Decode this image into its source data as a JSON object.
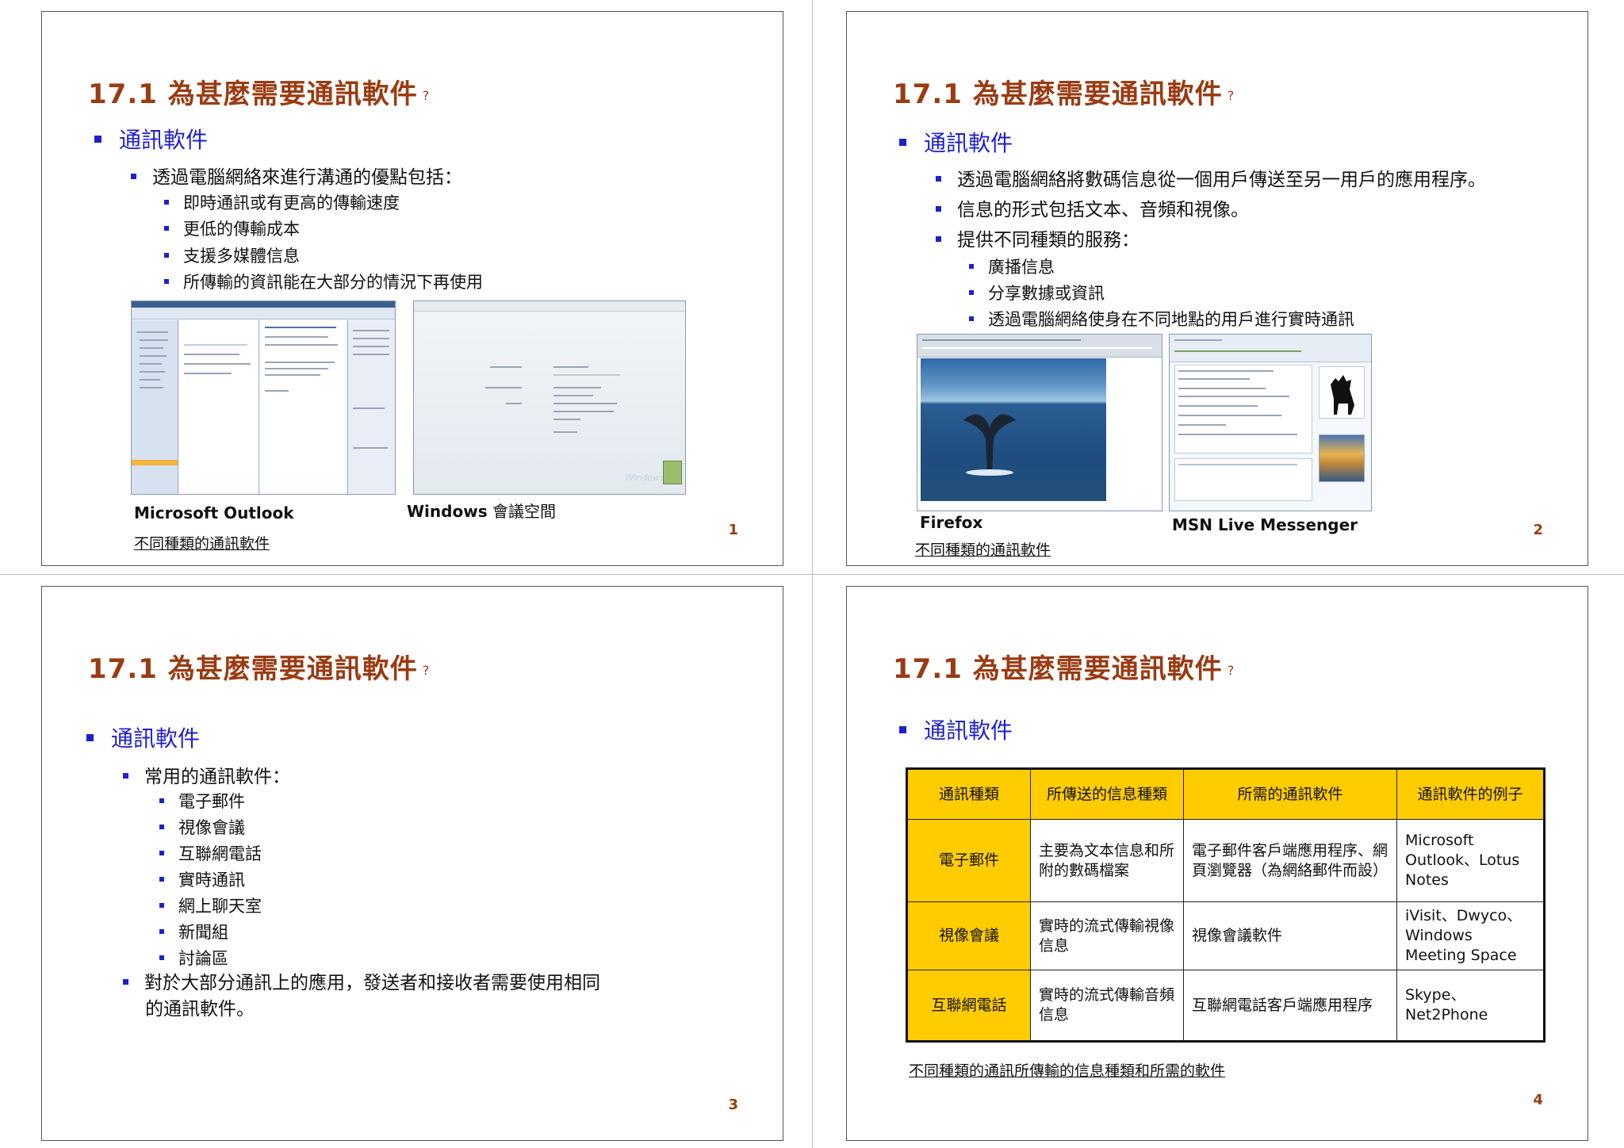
{
  "slides": [
    {
      "title": "17.1  為甚麼需要通訊軟件",
      "title_suffix": "?",
      "heading": "通訊軟件",
      "bullet": "透過電腦網絡來進行溝通的優點包括：",
      "subbullets": [
        "即時通訊或有更高的傳輸速度",
        "更低的傳輸成本",
        "支援多媒體信息",
        "所傳輸的資訊能在大部分的情況下再使用"
      ],
      "image_labels": {
        "outlook": "Microsoft Outlook",
        "meeting_bold": "Windows",
        "meeting_rest": " 會議空間"
      },
      "caption": "不同種類的通訊軟件",
      "page": "1"
    },
    {
      "title": "17.1  為甚麼需要通訊軟件",
      "title_suffix": "?",
      "heading": "通訊軟件",
      "bullets": [
        "透過電腦網絡將數碼信息從一個用戶傳送至另一用戶的應用程序。",
        "信息的形式包括文本、音頻和視像。",
        "提供不同種類的服務："
      ],
      "subbullets": [
        "廣播信息",
        "分享數據或資訊",
        "透過電腦網絡使身在不同地點的用戶進行實時通訊"
      ],
      "image_labels": {
        "firefox": "Firefox",
        "msn": "MSN Live Messenger"
      },
      "caption": "不同種類的通訊軟件",
      "page": "2"
    },
    {
      "title": "17.1  為甚麼需要通訊軟件",
      "title_suffix": "?",
      "heading": "通訊軟件",
      "bullet1": "常用的通訊軟件：",
      "subbullets": [
        "電子郵件",
        "視像會議",
        "互聯網電話",
        "實時通訊",
        "網上聊天室",
        "新聞組",
        "討論區"
      ],
      "bullet2_line1": "對於大部分通訊上的應用，發送者和接收者需要使用相同",
      "bullet2_line2": "的通訊軟件。",
      "page": "3"
    },
    {
      "title": "17.1  為甚麼需要通訊軟件",
      "title_suffix": "?",
      "heading": "通訊軟件",
      "table": {
        "headers": [
          "通訊種類",
          "所傳送的信息種類",
          "所需的通訊軟件",
          "通訊軟件的例子"
        ],
        "rows": [
          [
            "電子郵件",
            "主要為文本信息和所附的數碼檔案",
            "電子郵件客戶端應用程序、網頁瀏覽器（為網絡郵件而設）",
            "Microsoft Outlook、Lotus Notes"
          ],
          [
            "視像會議",
            "實時的流式傳輸視像信息",
            "視像會議軟件",
            "iVisit、Dwyco、Windows Meeting Space"
          ],
          [
            "互聯網電話",
            "實時的流式傳輸音頻信息",
            "互聯網電話客戶端應用程序",
            "Skype、Net2Phone"
          ]
        ]
      },
      "caption": "不同種類的通訊所傳輸的信息種類和所需的軟件",
      "page": "4"
    }
  ],
  "colors": {
    "title": "#9a3b12",
    "bullet": "#1f1fcc",
    "table_header": "#ffcc00"
  }
}
